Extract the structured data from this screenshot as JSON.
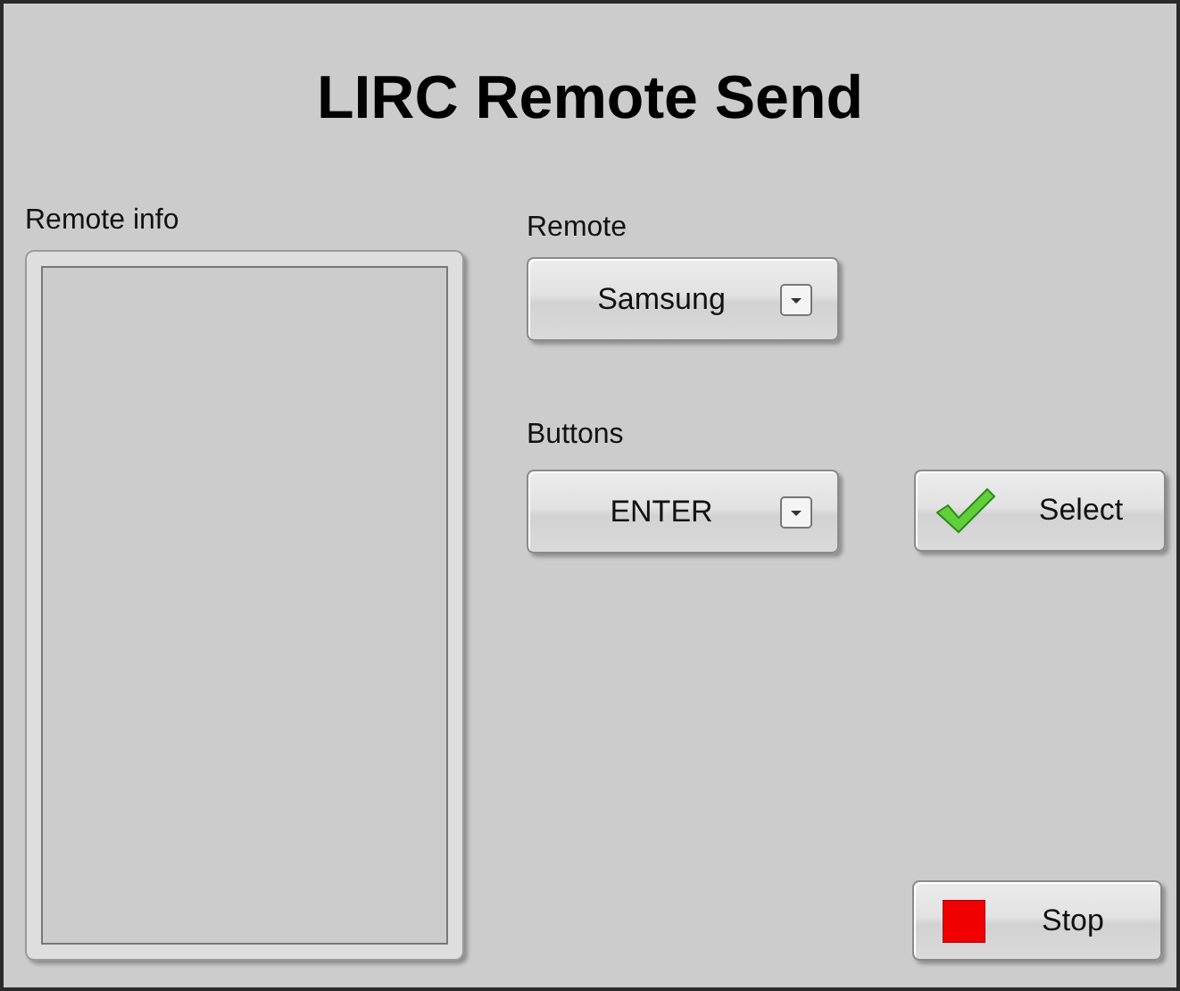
{
  "title": "LIRC Remote Send",
  "remote_info": {
    "label": "Remote info"
  },
  "remote": {
    "label": "Remote",
    "value": "Samsung"
  },
  "buttons": {
    "label": "Buttons",
    "value": "ENTER"
  },
  "select_button": {
    "label": "Select"
  },
  "stop_button": {
    "label": "Stop"
  }
}
